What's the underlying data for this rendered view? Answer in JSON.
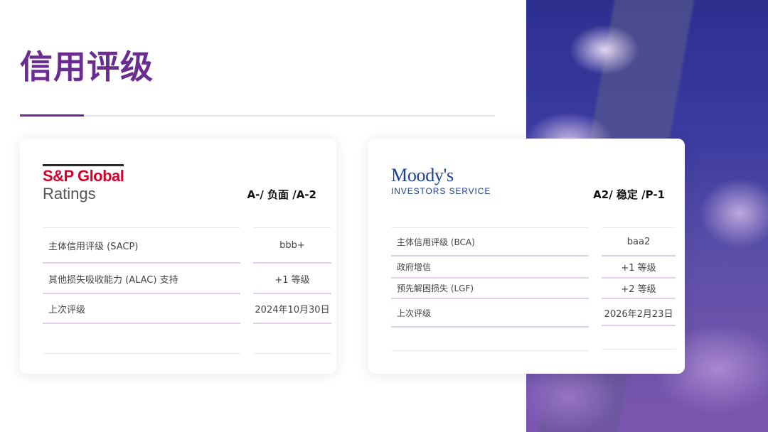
{
  "page": {
    "title": "信用评级"
  },
  "sp": {
    "logo_brand": "S&P Global",
    "logo_sub": "Ratings",
    "headline": "A-/ 负面 /A-2",
    "rows": [
      {
        "label": "主体信用评级 (SACP)",
        "value": "bbb+"
      },
      {
        "label": "其他损失吸收能力 (ALAC) 支持",
        "value": "+1 等级"
      },
      {
        "label": "上次评级",
        "value": "2024年10月30日"
      }
    ]
  },
  "moodys": {
    "logo_brand": "Moody's",
    "logo_sub": "INVESTORS SERVICE",
    "headline": "A2/ 稳定 /P-1",
    "rows": [
      {
        "label": "主体信用评级 (BCA)",
        "value": "baa2"
      },
      {
        "label": "政府增信",
        "value": "+1 等级"
      },
      {
        "label": "预先解困损失 (LGF)",
        "value": "+2 等级"
      },
      {
        "label": "上次评级",
        "value": "2026年2月23日"
      }
    ]
  }
}
